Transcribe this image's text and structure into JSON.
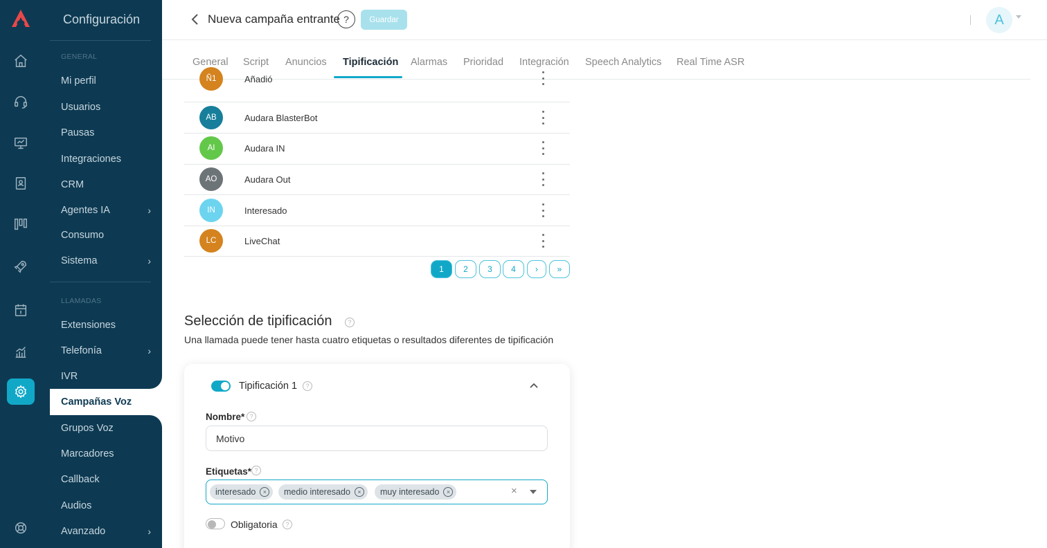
{
  "sidebar": {
    "title": "Configuración",
    "sections": [
      {
        "heading": "GENERAL"
      },
      {
        "heading": "LLAMADAS"
      }
    ],
    "general_items": [
      {
        "label": "Mi perfil"
      },
      {
        "label": "Usuarios"
      },
      {
        "label": "Pausas"
      },
      {
        "label": "Integraciones"
      },
      {
        "label": "CRM"
      },
      {
        "label": "Agentes IA",
        "chevron": "›"
      },
      {
        "label": "Consumo"
      },
      {
        "label": "Sistema",
        "chevron": "›"
      }
    ],
    "call_items": [
      {
        "label": "Extensiones"
      },
      {
        "label": "Telefonía",
        "chevron": "›"
      },
      {
        "label": "IVR"
      },
      {
        "label": "Campañas Voz"
      },
      {
        "label": "Grupos Voz"
      },
      {
        "label": "Marcadores"
      },
      {
        "label": "Callback"
      },
      {
        "label": "Audios"
      },
      {
        "label": "Avanzado",
        "chevron": "›"
      }
    ]
  },
  "rail_icons": [
    "home-icon",
    "headset-icon",
    "monitor-icon",
    "contacts-book-icon",
    "kanban-icon",
    "rocket-icon",
    "calendar-icon",
    "chart-icon",
    "settings-icon",
    "help-lifebuoy-icon"
  ],
  "header": {
    "title": "Nueva campaña entrante",
    "help_symbol": "?",
    "save_label": "Guardar",
    "divider": "|",
    "avatar_letter": "A"
  },
  "tabs": [
    {
      "label": "General"
    },
    {
      "label": "Script"
    },
    {
      "label": "Anuncios"
    },
    {
      "label": "Tipificación",
      "active": true
    },
    {
      "label": "Alarmas"
    },
    {
      "label": "Prioridad"
    },
    {
      "label": "Integración"
    },
    {
      "label": "Speech Analytics"
    },
    {
      "label": "Real Time ASR"
    }
  ],
  "list": [
    {
      "initials": "Ñ1",
      "name": "Añadió",
      "color": "#d4831f"
    },
    {
      "initials": "AB",
      "name": "Audara BlasterBot",
      "color": "#177f9b"
    },
    {
      "initials": "AI",
      "name": "Audara IN",
      "color": "#63c84a"
    },
    {
      "initials": "AO",
      "name": "Audara Out",
      "color": "#6d7478"
    },
    {
      "initials": "IN",
      "name": "Interesado",
      "color": "#6dd4ef"
    },
    {
      "initials": "LC",
      "name": "LiveChat",
      "color": "#d4831f"
    }
  ],
  "pagination": [
    "1",
    "2",
    "3",
    "4",
    "›",
    "»"
  ],
  "pagination_current": "1",
  "section": {
    "title": "Selección de tipificación",
    "description": "Una llamada puede tener hasta cuatro etiquetas o resultados diferentes de tipificación"
  },
  "card": {
    "title": "Tipificación 1",
    "enabled": true,
    "name_label": "Nombre*",
    "name_value": "Motivo",
    "tags_label": "Etiquetas*",
    "tags": [
      "interesado",
      "medio interesado",
      "muy interesado"
    ],
    "clear_symbol": "×",
    "chip_remove_symbol": "×",
    "required_label": "Obligatoria",
    "required": false
  },
  "colors": {
    "sidebar_bg": "#0d3a52",
    "accent": "#11a8c8",
    "save_disabled": "#a8e1ec"
  }
}
